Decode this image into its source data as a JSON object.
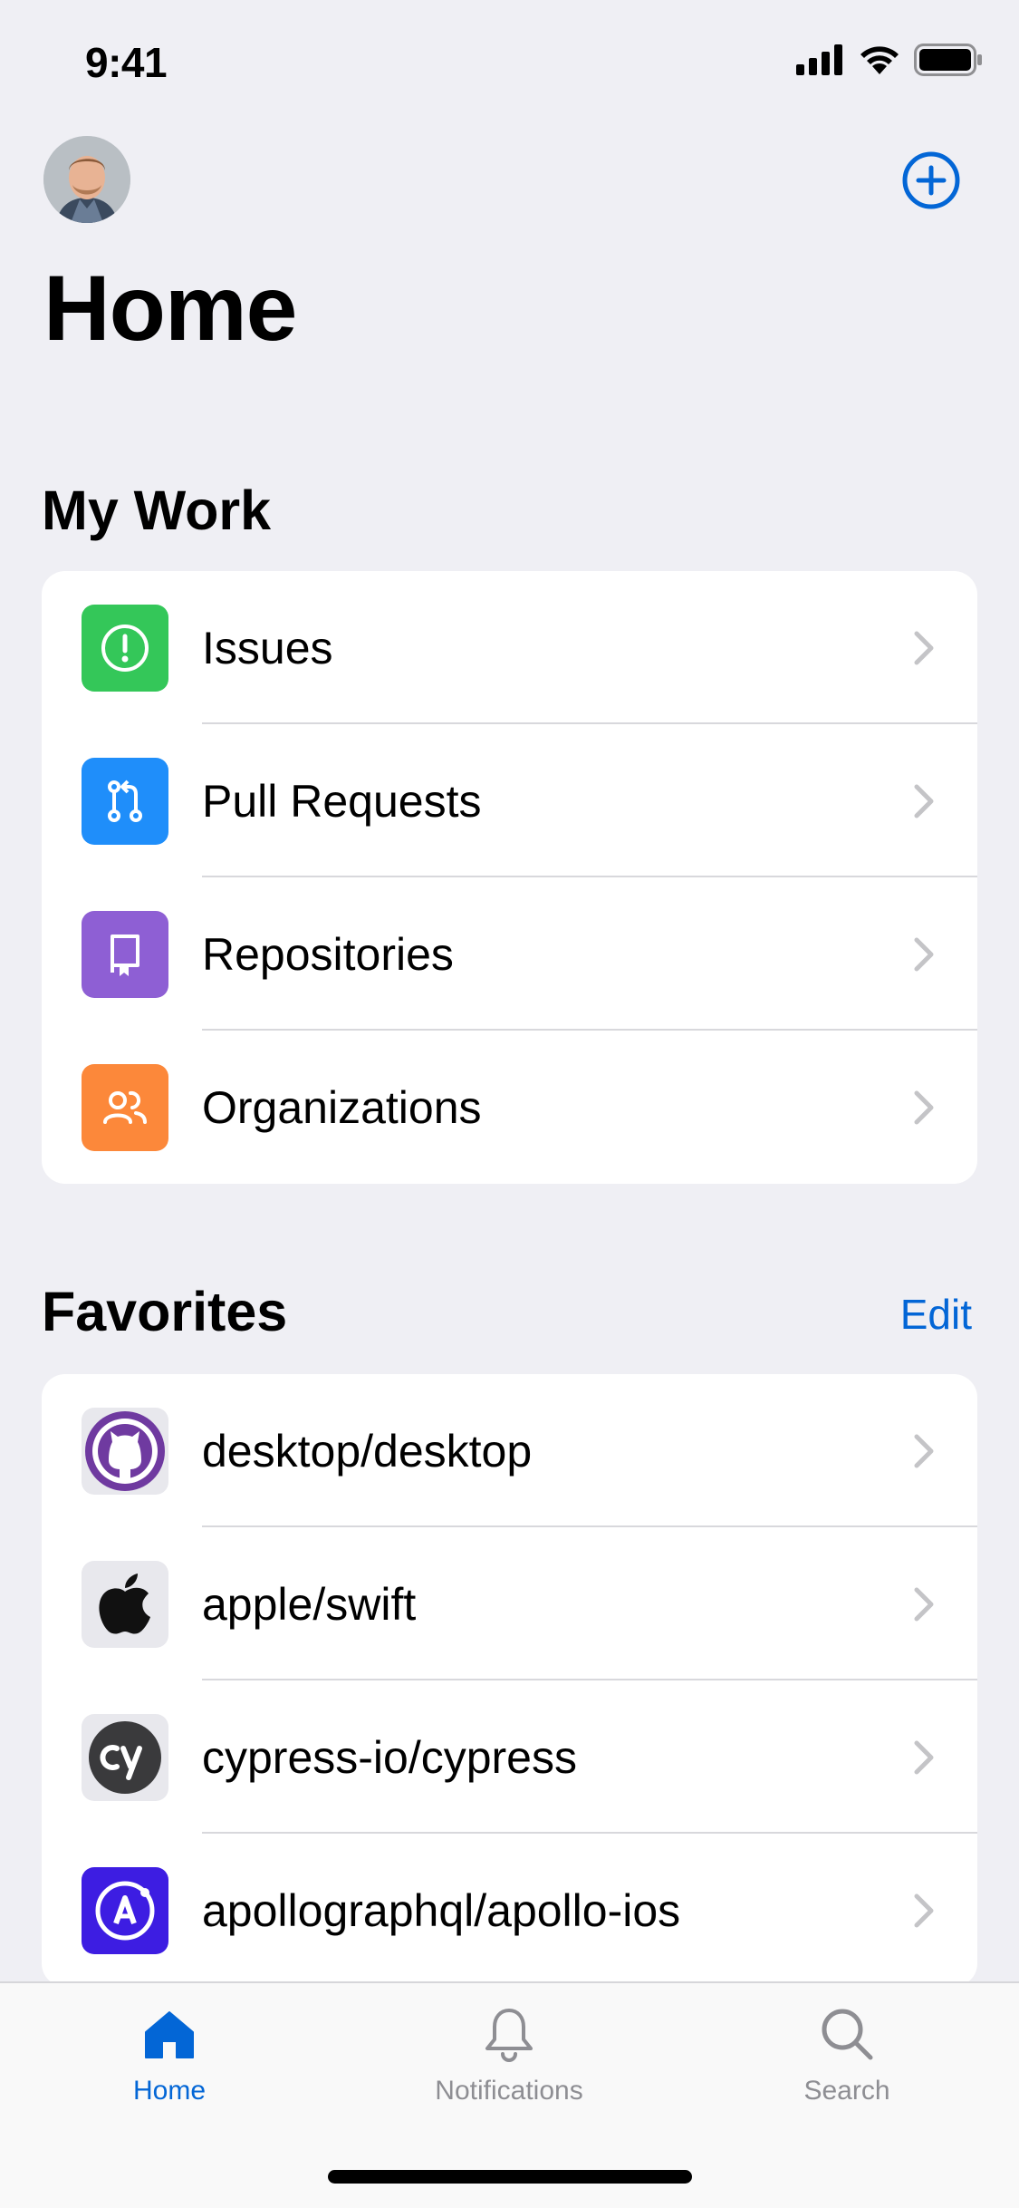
{
  "status_bar": {
    "time": "9:41"
  },
  "header": {
    "title": "Home"
  },
  "my_work": {
    "title": "My Work",
    "items": [
      {
        "label": "Issues",
        "icon": "issue-opened-icon",
        "color": "#34c759"
      },
      {
        "label": "Pull Requests",
        "icon": "git-pull-request-icon",
        "color": "#1f8efa"
      },
      {
        "label": "Repositories",
        "icon": "repo-icon",
        "color": "#8e5fd4"
      },
      {
        "label": "Organizations",
        "icon": "organization-icon",
        "color": "#fc883a"
      }
    ]
  },
  "favorites": {
    "title": "Favorites",
    "edit_label": "Edit",
    "items": [
      {
        "label": "desktop/desktop",
        "icon": "github-desktop-logo"
      },
      {
        "label": "apple/swift",
        "icon": "apple-logo"
      },
      {
        "label": "cypress-io/cypress",
        "icon": "cypress-logo"
      },
      {
        "label": "apollographql/apollo-ios",
        "icon": "apollo-logo"
      }
    ]
  },
  "tab_bar": {
    "tabs": [
      {
        "label": "Home",
        "icon": "home-icon",
        "active": true
      },
      {
        "label": "Notifications",
        "icon": "bell-icon",
        "active": false
      },
      {
        "label": "Search",
        "icon": "search-icon",
        "active": false
      }
    ]
  },
  "colors": {
    "accent": "#0366d6",
    "background": "#efeff4",
    "inactive": "#8e8e93"
  }
}
